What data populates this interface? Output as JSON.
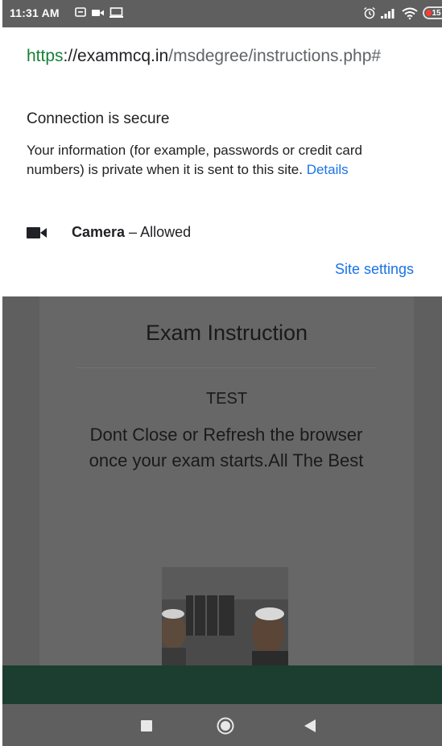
{
  "status_bar": {
    "time": "11:31 AM",
    "battery": "15",
    "icons": [
      "message-icon",
      "video-icon",
      "cast-icon",
      "alarm-icon",
      "signal-icon",
      "wifi-icon",
      "battery-icon"
    ]
  },
  "site_info": {
    "url_scheme": "https",
    "url_host": "://exammcq.in",
    "url_path": "/msdegree/instructions.php#",
    "connection_title": "Connection is secure",
    "connection_desc": "Your information (for example, passwords or credit card numbers) is private when it is sent to this site. ",
    "details_link": "Details",
    "permission_name": "Camera",
    "permission_status": " – Allowed",
    "site_settings": "Site settings"
  },
  "page": {
    "title": "Exam Instruction",
    "test_label": "TEST",
    "message": "Dont Close or Refresh the browser once your exam starts.All The Best"
  },
  "colors": {
    "accent_link": "#1a73e8",
    "secure_green": "#188038",
    "bottom_bar": "#1c3e30"
  }
}
